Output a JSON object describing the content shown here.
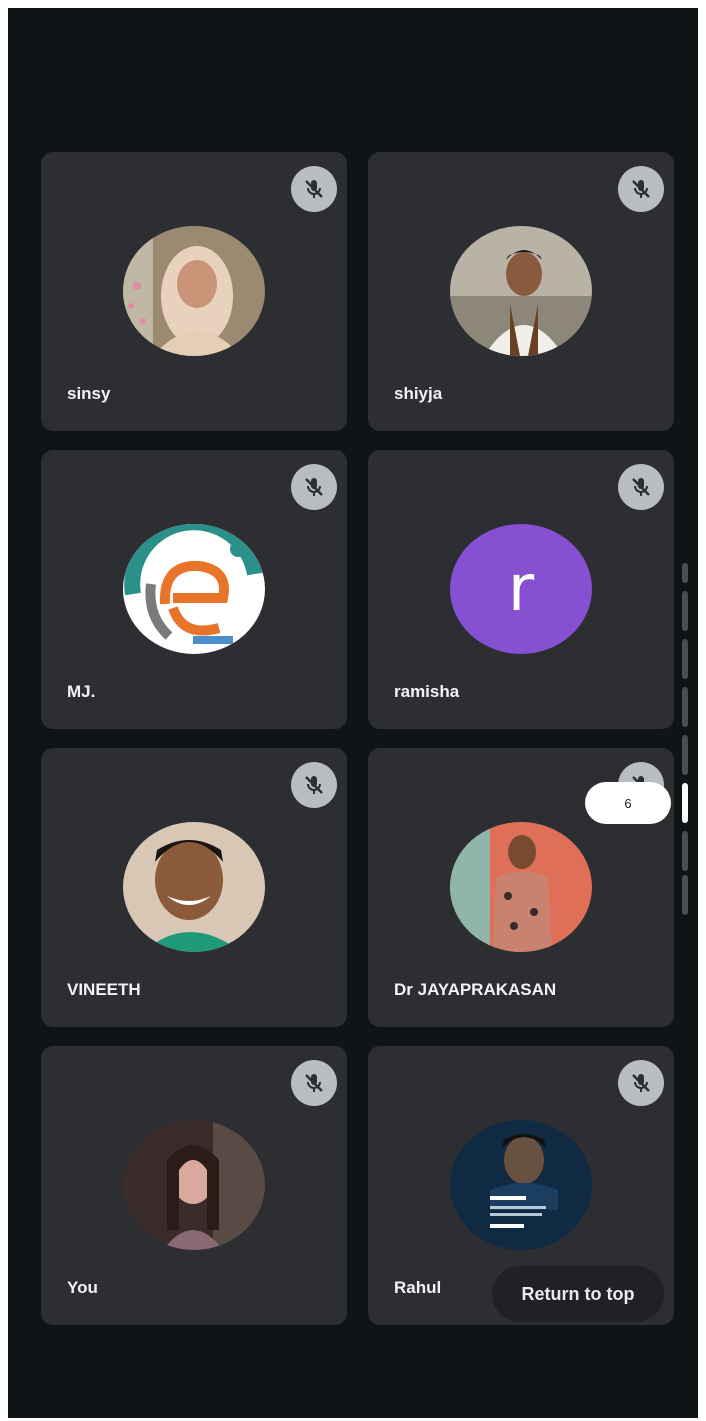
{
  "participants": [
    {
      "name": "sinsy",
      "avatar_type": "photo",
      "avatar_desc": "woman-in-hijab",
      "muted": true
    },
    {
      "name": "shiyja",
      "avatar_type": "photo",
      "avatar_desc": "man-outdoors",
      "muted": true
    },
    {
      "name": "MJ.",
      "avatar_type": "logo",
      "avatar_desc": "e-logo",
      "muted": true
    },
    {
      "name": "ramisha",
      "avatar_type": "letter",
      "avatar_letter": "r",
      "avatar_color": "#8650d2",
      "muted": true
    },
    {
      "name": "VINEETH",
      "avatar_type": "photo",
      "avatar_desc": "smiling-man",
      "muted": true
    },
    {
      "name": "Dr JAYAPRAKASAN",
      "avatar_type": "photo",
      "avatar_desc": "man-standing",
      "muted": true
    },
    {
      "name": "You",
      "avatar_type": "photo",
      "avatar_desc": "woman-portrait",
      "muted": true
    },
    {
      "name": "Rahul",
      "avatar_type": "photo",
      "avatar_desc": "poster",
      "muted": true
    }
  ],
  "pagination": {
    "current_page_label": "6",
    "active_segment": 6,
    "segments": 8
  },
  "return_to_top_label": "Return to top",
  "colors": {
    "background": "#0f1417",
    "tile": "#2c2e32",
    "mute_badge": "#b9bcc0",
    "letter_avatar": "#8650d2"
  },
  "icons": {
    "mute": "mic-off-icon"
  }
}
